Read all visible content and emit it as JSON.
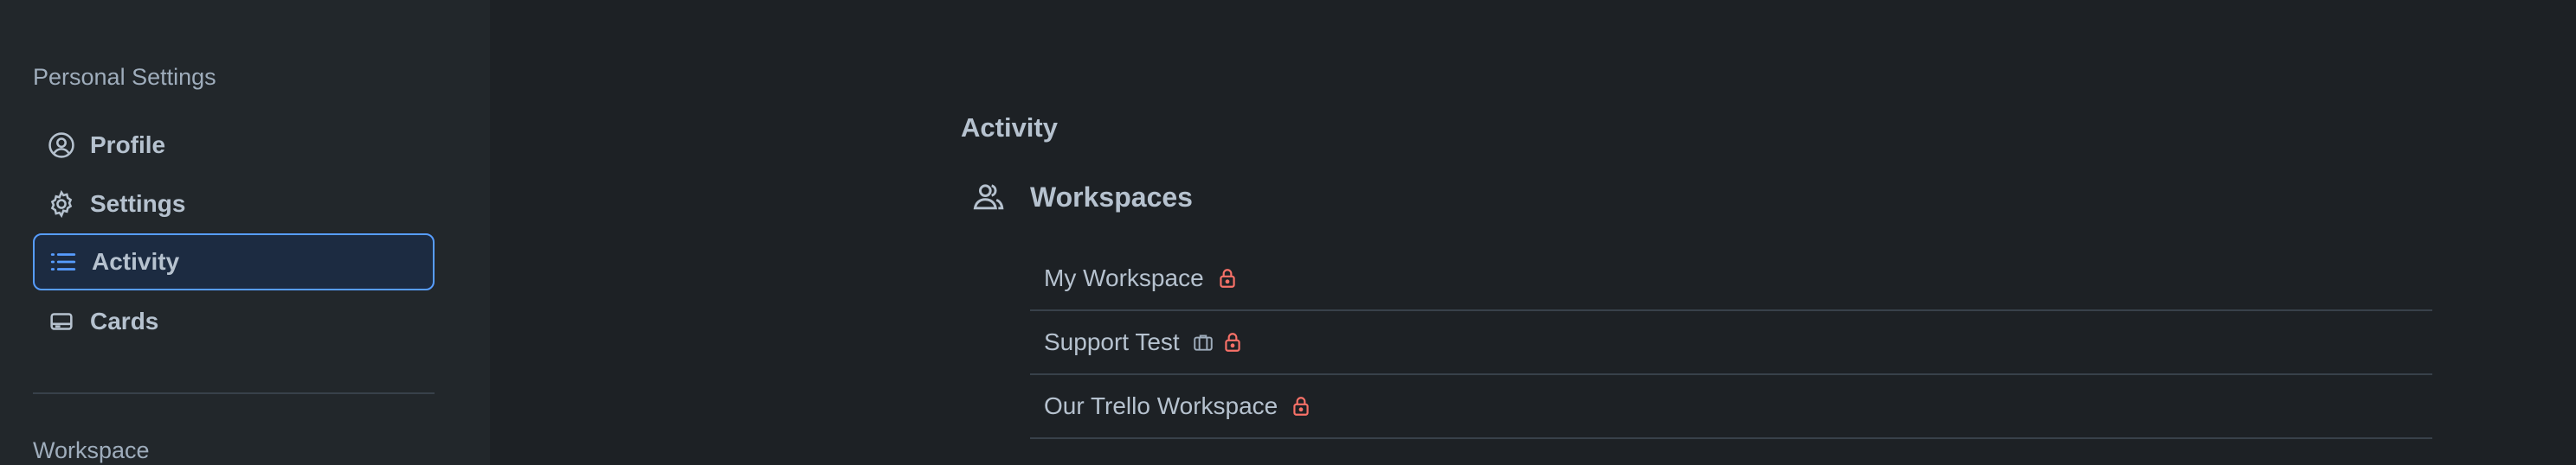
{
  "sidebar": {
    "personal_title": "Personal Settings",
    "items": [
      {
        "label": "Profile",
        "icon": "person-circle-icon"
      },
      {
        "label": "Settings",
        "icon": "gear-icon"
      },
      {
        "label": "Activity",
        "icon": "list-icon",
        "selected": true
      },
      {
        "label": "Cards",
        "icon": "card-icon"
      }
    ],
    "workspace_title": "Workspace"
  },
  "main": {
    "heading": "Activity",
    "workspaces": {
      "title": "Workspaces",
      "icon": "people-icon",
      "rows": [
        {
          "name": "My Workspace",
          "icons": [
            "lock-icon"
          ]
        },
        {
          "name": "Support Test",
          "icons": [
            "briefcase-icon",
            "lock-icon"
          ]
        },
        {
          "name": "Our Trello Workspace",
          "icons": [
            "lock-icon"
          ]
        }
      ]
    }
  },
  "colors": {
    "background": "#1d2125",
    "sidebar": "#22272b",
    "selected_border": "#579dff",
    "selected_bg": "#1c2b41",
    "lock": "#f87168"
  }
}
